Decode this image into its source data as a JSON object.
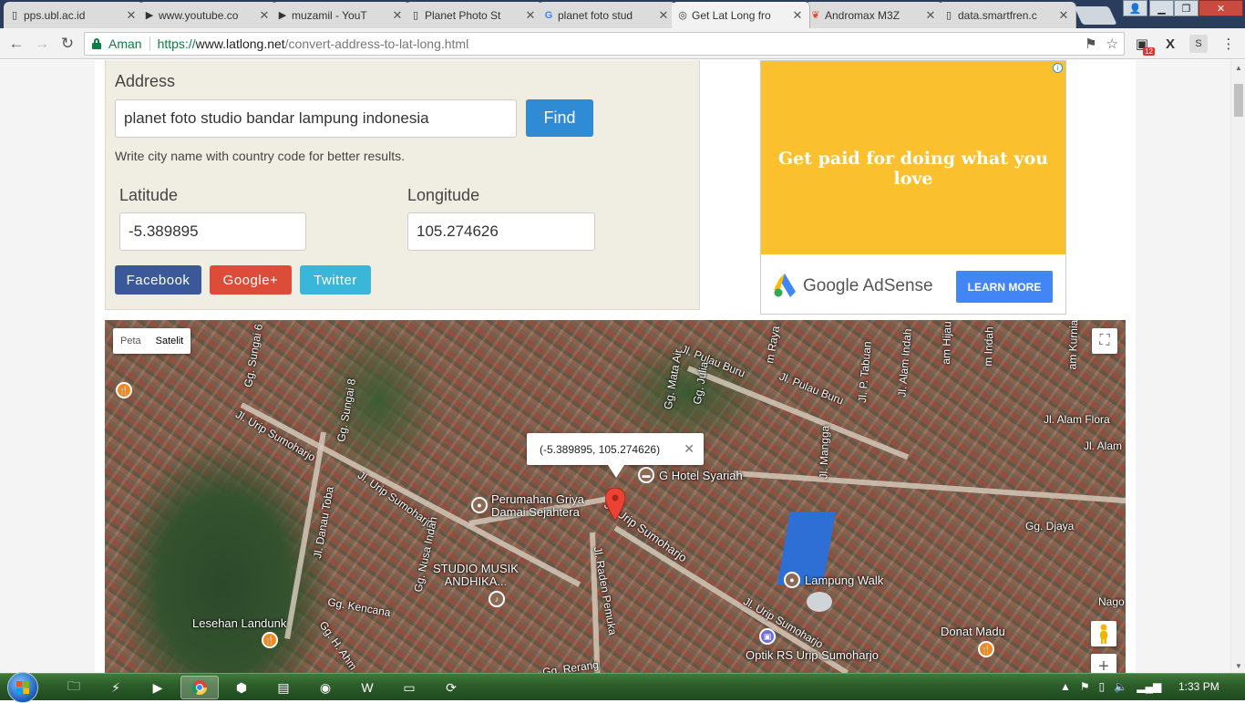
{
  "browser": {
    "tabs": [
      {
        "title": "pps.ubl.ac.id",
        "icon": "page-icon"
      },
      {
        "title": "www.youtube.co",
        "icon": "youtube-icon"
      },
      {
        "title": "muzamil - YouT",
        "icon": "youtube-icon"
      },
      {
        "title": "Planet Photo St",
        "icon": "page-icon"
      },
      {
        "title": "planet foto stud",
        "icon": "google-icon"
      },
      {
        "title": "Get Lat Long fro",
        "icon": "compass-icon"
      },
      {
        "title": "Andromax M3Z",
        "icon": "andromax-icon"
      },
      {
        "title": "data.smartfren.c",
        "icon": "page-icon"
      }
    ],
    "active_tab_index": 5,
    "security_label": "Aman",
    "url_scheme": "https://",
    "url_host": "www.latlong.net",
    "url_path": "/convert-address-to-lat-long.html",
    "extension_badge": "12"
  },
  "form": {
    "address_label": "Address",
    "address_value": "planet foto studio bandar lampung indonesia",
    "find_label": "Find",
    "hint": "Write city name with country code for better results.",
    "latitude_label": "Latitude",
    "latitude_value": "-5.389895",
    "longitude_label": "Longitude",
    "longitude_value": "105.274626",
    "share": {
      "facebook": "Facebook",
      "google": "Google+",
      "twitter": "Twitter"
    },
    "colors": {
      "find": "#2f8bd3",
      "facebook": "#3b5998",
      "google": "#dd4b39",
      "twitter": "#3ab7d8"
    }
  },
  "ad": {
    "headline": "Get paid for doing what you love",
    "brand": "Google AdSense",
    "cta": "LEARN MORE",
    "info": "i"
  },
  "map": {
    "type_map": "Peta",
    "type_satellite": "Satelit",
    "info_text": "(-5.389895, 105.274626)",
    "labels": {
      "urip1": "Jl. Urip Sumoharjo",
      "urip2": "Jl. Urip Sumoharjo",
      "urip3": "Jl. Urip Sumoharjo",
      "urip4": "Jl. Urip Sumoharjo",
      "sungai6": "Gg. Sungai 6",
      "sungai8": "Gg. Sungai 8",
      "pulau_buru1": "Jl. Pulau Buru",
      "pulau_buru2": "Jl. Pulau Buru",
      "mata_air": "Gg. Mata Air",
      "julia": "Gg. Julia",
      "raya": "m Raya",
      "tabuan": "Jl. P. Tabuan",
      "alam_indah": "Jl. Alam Indah",
      "alam_hijau": "am Hijau",
      "m_indah": "m Indah",
      "am_kurnia": "am Kurnia",
      "alam_flora": "Jl. Alam Flora",
      "jl_alam": "Jl. Alam",
      "mangga": "Jl. Mangga",
      "hotel": "G Hotel Syariah",
      "perumahan": "Perumahan Griya\nDamai Sejahtera",
      "danau_toba": "Jl. Danau Toba",
      "nusa_indah": "Gg. Nusa Indah",
      "studio_musik": "STUDIO MUSIK\nANDHIKA...",
      "raden_pemuka": "Jl. Raden Pemuka",
      "djaya": "Gg. Djaya",
      "lampung_walk": "Lampung Walk",
      "kencana": "Gg. Kencana",
      "lesehan": "Lesehan Landunk",
      "h_ahm": "Gg. H. Ahm",
      "nago": "Nago",
      "donat": "Donat Madu",
      "optik": "Optik RS Urip Sumoharjo",
      "rerang": "Gg. Rerang"
    }
  },
  "taskbar": {
    "clock": "1:33 PM"
  }
}
